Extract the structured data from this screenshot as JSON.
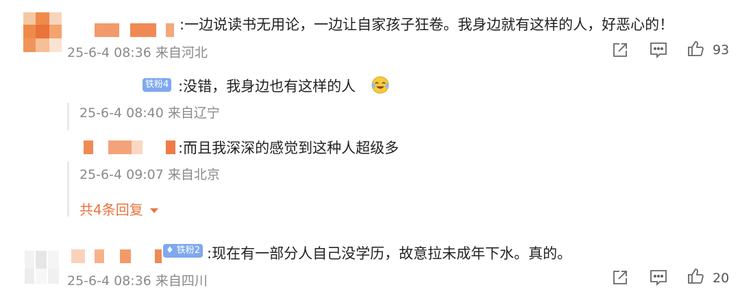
{
  "comments": [
    {
      "text": ":一边说读书无用论，一边让自家孩子狂卷。我身边就有这样的人，好恶心的！",
      "meta": "25-6-4 08:36 来自河北",
      "likes": "93",
      "avatar_colors": [
        "#f08a4b",
        "#e8b07a",
        "#f4c39a"
      ],
      "replies": [
        {
          "badge": "铁粉4",
          "text": ":没错，我身边也有这样的人",
          "emoji": "laugh-cry-emoji",
          "meta": "25-6-4 08:40 来自辽宁"
        },
        {
          "badge": "",
          "text": ":而且我深深的感觉到这种人超级多",
          "meta": "25-6-4 09:07 来自北京"
        }
      ],
      "more_replies": "共4条回复"
    },
    {
      "text": ":现在有一部分人自己没学历，故意拉未成年下水。真的。",
      "meta": "25-6-4 08:36 来自四川",
      "likes": "20",
      "badge": "铁粉2"
    }
  ],
  "colors": {
    "badge_blue": "#7fa8ee",
    "accent_orange": "#eb7340",
    "muted": "#8a8a8a"
  },
  "icons": [
    "share-icon",
    "comment-icon",
    "like-icon"
  ]
}
